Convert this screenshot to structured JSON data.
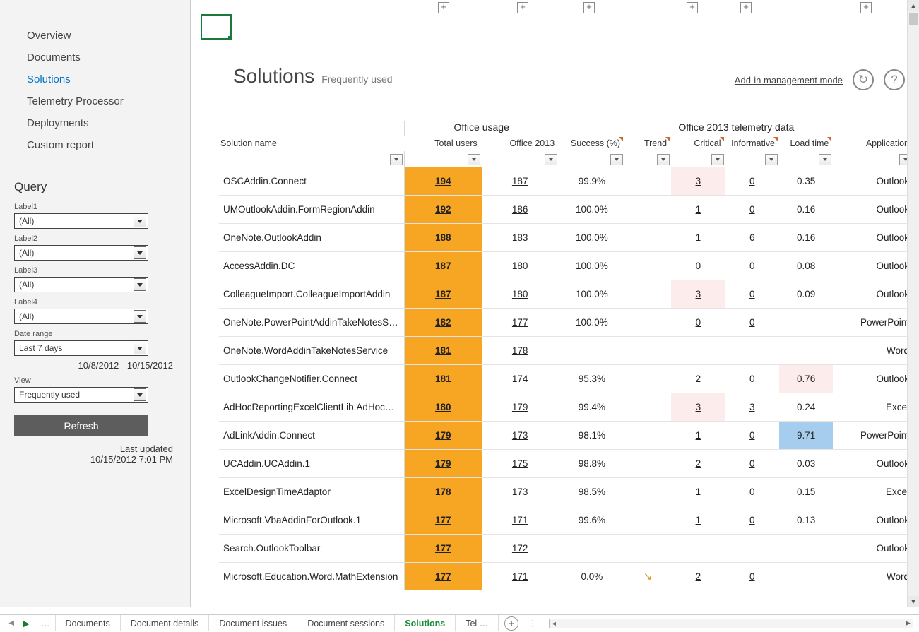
{
  "nav": {
    "items": [
      "Overview",
      "Documents",
      "Solutions",
      "Telemetry Processor",
      "Deployments",
      "Custom report"
    ],
    "active": "Solutions"
  },
  "query": {
    "title": "Query",
    "labels": {
      "l1": "Label1",
      "l2": "Label2",
      "l3": "Label3",
      "l4": "Label4",
      "date": "Date range",
      "view": "View"
    },
    "values": {
      "l1": "(All)",
      "l2": "(All)",
      "l3": "(All)",
      "l4": "(All)",
      "date": "Last 7 days",
      "view": "Frequently used"
    },
    "date_range_text": "10/8/2012 - 10/15/2012",
    "refresh": "Refresh",
    "last_updated_label": "Last updated",
    "last_updated_time": "10/15/2012 7:01 PM"
  },
  "header": {
    "title": "Solutions",
    "subtitle": "Frequently used",
    "mode_link": "Add-in management mode"
  },
  "table": {
    "group1": "Office usage",
    "group2": "Office 2013 telemetry data",
    "columns": {
      "name": "Solution name",
      "total": "Total users",
      "office": "Office 2013",
      "success": "Success (%)",
      "trend": "Trend",
      "critical": "Critical",
      "informative": "Informative",
      "load": "Load time",
      "app": "Application"
    },
    "rows": [
      {
        "name": "OSCAddin.Connect",
        "total": "194",
        "office": "187",
        "success": "99.9%",
        "critical": "3",
        "crit_flag": true,
        "informative": "0",
        "load": "0.35",
        "app": "Outlook"
      },
      {
        "name": "UMOutlookAddin.FormRegionAddin",
        "total": "192",
        "office": "186",
        "success": "100.0%",
        "critical": "1",
        "informative": "0",
        "load": "0.16",
        "app": "Outlook"
      },
      {
        "name": "OneNote.OutlookAddin",
        "total": "188",
        "office": "183",
        "success": "100.0%",
        "critical": "1",
        "informative": "6",
        "load": "0.16",
        "app": "Outlook"
      },
      {
        "name": "AccessAddin.DC",
        "total": "187",
        "office": "180",
        "success": "100.0%",
        "critical": "0",
        "informative": "0",
        "load": "0.08",
        "app": "Outlook"
      },
      {
        "name": "ColleagueImport.ColleagueImportAddin",
        "total": "187",
        "office": "180",
        "success": "100.0%",
        "critical": "3",
        "crit_flag": true,
        "informative": "0",
        "load": "0.09",
        "app": "Outlook"
      },
      {
        "name": "OneNote.PowerPointAddinTakeNotesService",
        "total": "182",
        "office": "177",
        "success": "100.0%",
        "critical": "0",
        "informative": "0",
        "load": "",
        "app": "PowerPoint"
      },
      {
        "name": "OneNote.WordAddinTakeNotesService",
        "total": "181",
        "office": "178",
        "success": "",
        "critical": "",
        "informative": "",
        "load": "",
        "app": "Word"
      },
      {
        "name": "OutlookChangeNotifier.Connect",
        "total": "181",
        "office": "174",
        "success": "95.3%",
        "critical": "2",
        "informative": "0",
        "load": "0.76",
        "load_flag": "pink",
        "app": "Outlook"
      },
      {
        "name": "AdHocReportingExcelClientLib.AdHocReporting",
        "total": "180",
        "office": "179",
        "success": "99.4%",
        "critical": "3",
        "crit_flag": true,
        "informative": "3",
        "load": "0.24",
        "app": "Excel"
      },
      {
        "name": "AdLinkAddin.Connect",
        "total": "179",
        "office": "173",
        "success": "98.1%",
        "critical": "1",
        "informative": "0",
        "load": "9.71",
        "load_flag": "blue",
        "app": "PowerPoint"
      },
      {
        "name": "UCAddin.UCAddin.1",
        "total": "179",
        "office": "175",
        "success": "98.8%",
        "critical": "2",
        "informative": "0",
        "load": "0.03",
        "app": "Outlook"
      },
      {
        "name": "ExcelDesignTimeAdaptor",
        "total": "178",
        "office": "173",
        "success": "98.5%",
        "critical": "1",
        "informative": "0",
        "load": "0.15",
        "app": "Excel"
      },
      {
        "name": "Microsoft.VbaAddinForOutlook.1",
        "total": "177",
        "office": "171",
        "success": "99.6%",
        "critical": "1",
        "informative": "0",
        "load": "0.13",
        "app": "Outlook"
      },
      {
        "name": "Search.OutlookToolbar",
        "total": "177",
        "office": "172",
        "success": "",
        "critical": "",
        "informative": "",
        "load": "",
        "app": "Outlook"
      },
      {
        "name": "Microsoft.Education.Word.MathExtension",
        "total": "177",
        "office": "171",
        "success": "0.0%",
        "trend": "↘",
        "critical": "2",
        "informative": "0",
        "load": "",
        "app": "Word"
      }
    ]
  },
  "sheets": {
    "tabs": [
      "Documents",
      "Document details",
      "Document issues",
      "Document sessions",
      "Solutions",
      "Tel …"
    ],
    "active": "Solutions"
  }
}
